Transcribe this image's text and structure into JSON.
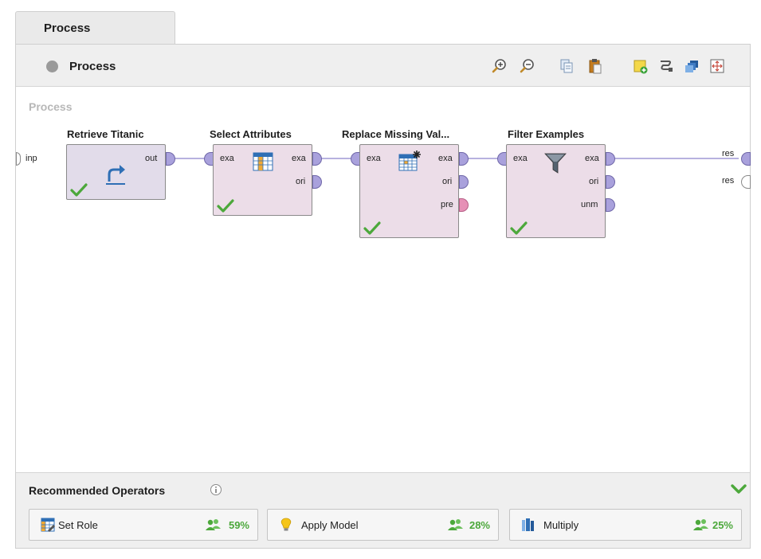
{
  "tab": {
    "label": "Process"
  },
  "toolbar": {
    "title": "Process",
    "icons": [
      "zoom-in-icon",
      "zoom-out-icon",
      "copy-icon",
      "paste-icon",
      "add-note-icon",
      "auto-wire-icon",
      "layers-icon",
      "fit-view-icon"
    ]
  },
  "canvas": {
    "label": "Process",
    "left_port": "inp",
    "right_ports": [
      "res",
      "res"
    ],
    "operators": [
      {
        "title": "Retrieve Titanic",
        "inputs": [],
        "outputs": [
          "out"
        ],
        "icon": "retrieve-icon"
      },
      {
        "title": "Select Attributes",
        "inputs": [
          "exa"
        ],
        "outputs": [
          "exa",
          "ori"
        ],
        "icon": "select-attributes-icon"
      },
      {
        "title": "Replace Missing Val...",
        "inputs": [
          "exa"
        ],
        "outputs": [
          "exa",
          "ori",
          "pre"
        ],
        "icon": "replace-missing-icon"
      },
      {
        "title": "Filter Examples",
        "inputs": [
          "exa"
        ],
        "outputs": [
          "exa",
          "ori",
          "unm"
        ],
        "icon": "filter-icon"
      }
    ]
  },
  "recommended": {
    "title": "Recommended Operators",
    "items": [
      {
        "label": "Set Role",
        "percent": "59%",
        "icon": "set-role-icon"
      },
      {
        "label": "Apply Model",
        "percent": "28%",
        "icon": "lightbulb-icon"
      },
      {
        "label": "Multiply",
        "percent": "25%",
        "icon": "multiply-icon"
      }
    ]
  },
  "colors": {
    "port": "#a9a1dc",
    "operator_bg": "#ecdde8",
    "check": "#4ca83b",
    "wire": "#8c84cc"
  }
}
